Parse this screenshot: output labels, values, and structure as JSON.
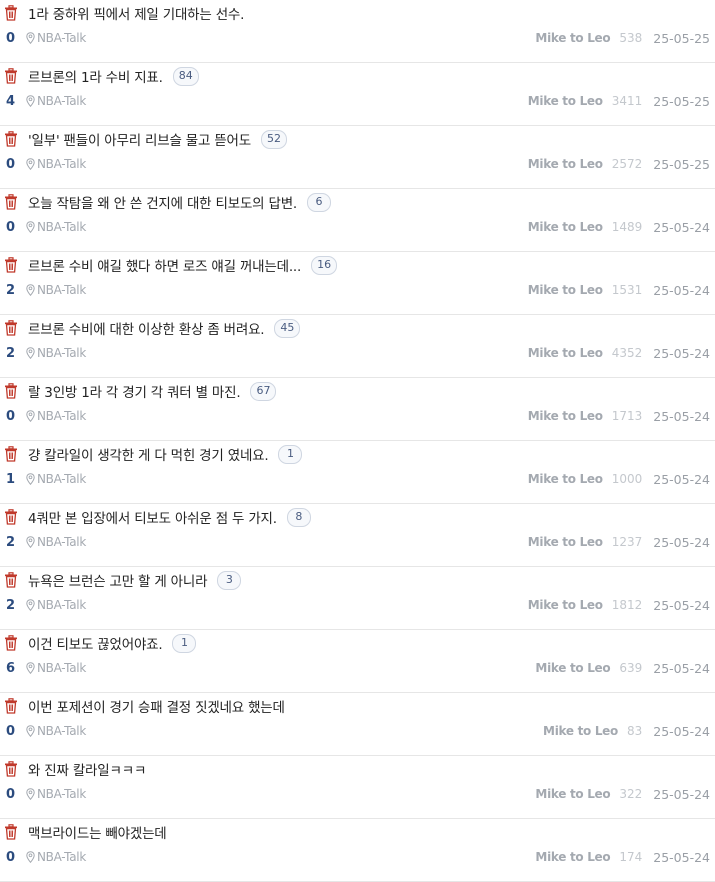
{
  "icons": {
    "delete": "trash-icon",
    "category": "location-pin-icon"
  },
  "colors": {
    "trash": "#c0392b",
    "number": "#2b4b7e",
    "meta": "#a4a9b0",
    "badge_border": "#cfd6e1"
  },
  "posts": [
    {
      "title": "1라 중하위 픽에서 제일 기대하는 선수.",
      "comments": "",
      "number": "0",
      "category": "NBA-Talk",
      "author": "Mike to Leo",
      "views": "538",
      "date": "25-05-25"
    },
    {
      "title": "르브론의 1라 수비 지표.",
      "comments": "84",
      "number": "4",
      "category": "NBA-Talk",
      "author": "Mike to Leo",
      "views": "3411",
      "date": "25-05-25"
    },
    {
      "title": "'일부' 팬들이 아무리 리브슬 물고 뜯어도",
      "comments": "52",
      "number": "0",
      "category": "NBA-Talk",
      "author": "Mike to Leo",
      "views": "2572",
      "date": "25-05-25"
    },
    {
      "title": "오늘 작탐을 왜 안 쓴 건지에 대한 티보도의 답변.",
      "comments": "6",
      "number": "0",
      "category": "NBA-Talk",
      "author": "Mike to Leo",
      "views": "1489",
      "date": "25-05-24"
    },
    {
      "title": "르브론 수비 얘길 했다 하면 로즈 얘길 꺼내는데...",
      "comments": "16",
      "number": "2",
      "category": "NBA-Talk",
      "author": "Mike to Leo",
      "views": "1531",
      "date": "25-05-24"
    },
    {
      "title": "르브론 수비에 대한 이상한 환상 좀 버려요.",
      "comments": "45",
      "number": "2",
      "category": "NBA-Talk",
      "author": "Mike to Leo",
      "views": "4352",
      "date": "25-05-24"
    },
    {
      "title": "랄 3인방 1라 각 경기 각 쿼터 별 마진.",
      "comments": "67",
      "number": "0",
      "category": "NBA-Talk",
      "author": "Mike to Leo",
      "views": "1713",
      "date": "25-05-24"
    },
    {
      "title": "걍 칼라일이 생각한 게 다 먹힌 경기 였네요.",
      "comments": "1",
      "number": "1",
      "category": "NBA-Talk",
      "author": "Mike to Leo",
      "views": "1000",
      "date": "25-05-24"
    },
    {
      "title": "4쿼만 본 입장에서 티보도 아쉬운 점 두 가지.",
      "comments": "8",
      "number": "2",
      "category": "NBA-Talk",
      "author": "Mike to Leo",
      "views": "1237",
      "date": "25-05-24"
    },
    {
      "title": "뉴욕은 브런슨 고만 할 게 아니라",
      "comments": "3",
      "number": "2",
      "category": "NBA-Talk",
      "author": "Mike to Leo",
      "views": "1812",
      "date": "25-05-24"
    },
    {
      "title": "이건 티보도 끊었어야죠.",
      "comments": "1",
      "number": "6",
      "category": "NBA-Talk",
      "author": "Mike to Leo",
      "views": "639",
      "date": "25-05-24"
    },
    {
      "title": "이번 포제션이 경기 승패 결정 짓겠네요 했는데",
      "comments": "",
      "number": "0",
      "category": "NBA-Talk",
      "author": "Mike to Leo",
      "views": "83",
      "date": "25-05-24"
    },
    {
      "title": "와 진짜 칼라일ㅋㅋㅋ",
      "comments": "",
      "number": "0",
      "category": "NBA-Talk",
      "author": "Mike to Leo",
      "views": "322",
      "date": "25-05-24"
    },
    {
      "title": "맥브라이드는 빼야겠는데",
      "comments": "",
      "number": "0",
      "category": "NBA-Talk",
      "author": "Mike to Leo",
      "views": "174",
      "date": "25-05-24"
    }
  ]
}
